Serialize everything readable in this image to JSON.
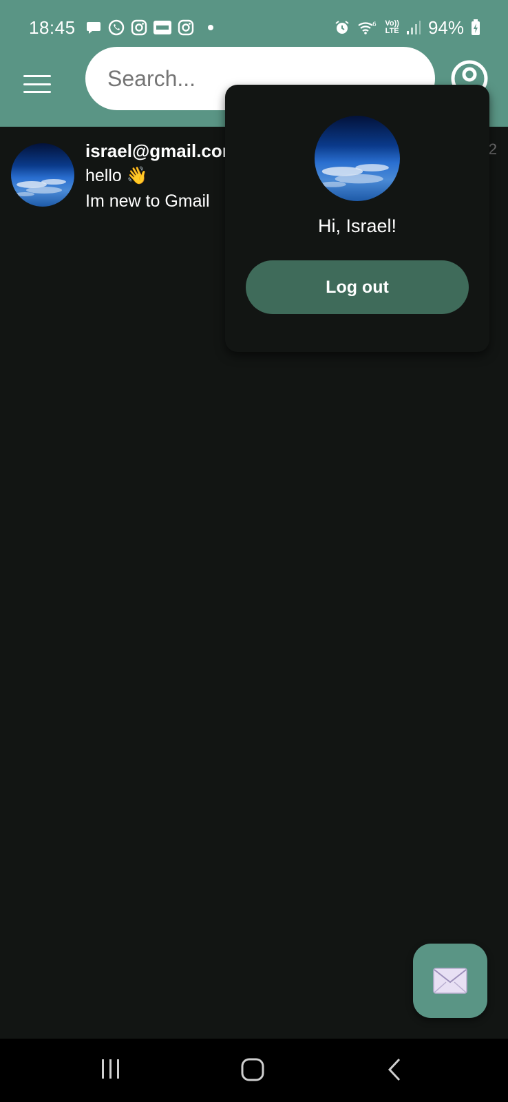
{
  "status_bar": {
    "time": "18:45",
    "battery": "94%",
    "notification_icons": [
      "chat-bubble-icon",
      "whatsapp-icon",
      "instagram-icon",
      "ynet-icon",
      "instagram-icon"
    ],
    "status_icons": [
      "alarm-icon",
      "wifi-6-icon",
      "volte-lte-icon",
      "signal-icon",
      "battery-charging-icon"
    ],
    "volte_line1": "Vo))",
    "volte_line2": "LTE"
  },
  "header": {
    "menu_icon": "hamburger-menu-icon",
    "search_placeholder": "Search...",
    "profile_icon": "account-circle-icon"
  },
  "mails": [
    {
      "sender": "israel@gmail.com",
      "subject": "hello 👋",
      "preview": "Im new to Gmail",
      "time": "2"
    }
  ],
  "profile_popup": {
    "greeting": "Hi, Israel!",
    "logout_label": "Log out"
  },
  "fab": {
    "icon": "envelope-icon"
  },
  "nav_bar": {
    "icons": [
      "recent-apps-icon",
      "home-icon",
      "back-icon"
    ]
  },
  "colors": {
    "accent": "#5a9585",
    "button": "#3f6b5a",
    "background": "#121513",
    "text": "#ffffff"
  }
}
